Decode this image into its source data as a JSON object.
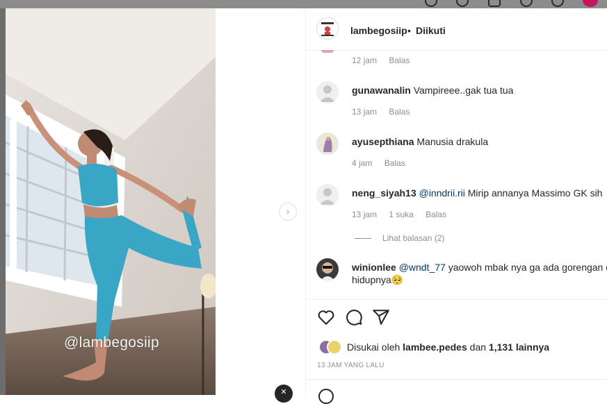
{
  "post": {
    "watermark": "@lambegosiip",
    "mute_icon": "speaker-muted-icon",
    "next_icon": "chevron-right-icon"
  },
  "header": {
    "username": "lambegosiip",
    "separator": "•",
    "follow_status": "Diikuti"
  },
  "comments": [
    {
      "username": "",
      "text": "",
      "time": "12 jam",
      "reply": "Balas",
      "likes": ""
    },
    {
      "username": "gunawanalin",
      "mention": "",
      "text": "Vampireee..gak tua tua",
      "time": "13 jam",
      "reply": "Balas",
      "likes": ""
    },
    {
      "username": "ayusepthiana",
      "mention": "",
      "text": "Manusia drakula",
      "time": "4 jam",
      "reply": "Balas",
      "likes": ""
    },
    {
      "username": "neng_siyah13",
      "mention": "@inndrii.rii",
      "text": "Mirip annanya Massimo GK sih",
      "time": "13 jam",
      "likes": "1 suka",
      "reply": "Balas"
    },
    {
      "username": "winionlee",
      "mention": "@wndt_77",
      "text": "yaowoh mbak nya ga ada gorengan d",
      "text2": "hidupnya🥺"
    }
  ],
  "view_replies": "Lihat balasan (2)",
  "actions": {
    "like_icon": "heart-icon",
    "comment_icon": "comment-icon",
    "share_icon": "send-icon"
  },
  "likes": {
    "prefix": "Disukai oleh",
    "user": "lambee.pedes",
    "conjunction": "dan",
    "count": "1,131 lainnya"
  },
  "time_ago": "13 JAM YANG LALU",
  "colors": {
    "text": "#262626",
    "muted": "#8e8e8e",
    "mention": "#00376b",
    "outfit": "#3aa6c6"
  }
}
